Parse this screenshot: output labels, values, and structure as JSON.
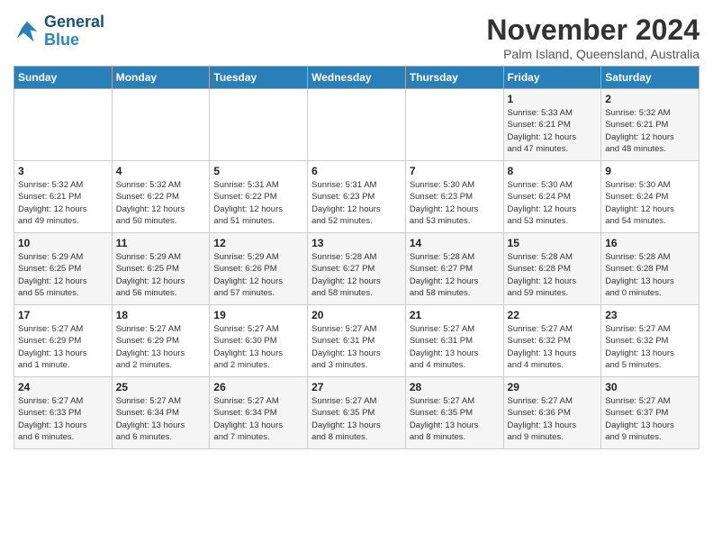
{
  "header": {
    "logo_line1": "General",
    "logo_line2": "Blue",
    "month_title": "November 2024",
    "location": "Palm Island, Queensland, Australia"
  },
  "days_of_week": [
    "Sunday",
    "Monday",
    "Tuesday",
    "Wednesday",
    "Thursday",
    "Friday",
    "Saturday"
  ],
  "weeks": [
    [
      {
        "day": "",
        "info": ""
      },
      {
        "day": "",
        "info": ""
      },
      {
        "day": "",
        "info": ""
      },
      {
        "day": "",
        "info": ""
      },
      {
        "day": "",
        "info": ""
      },
      {
        "day": "1",
        "info": "Sunrise: 5:33 AM\nSunset: 6:21 PM\nDaylight: 12 hours\nand 47 minutes."
      },
      {
        "day": "2",
        "info": "Sunrise: 5:32 AM\nSunset: 6:21 PM\nDaylight: 12 hours\nand 48 minutes."
      }
    ],
    [
      {
        "day": "3",
        "info": "Sunrise: 5:32 AM\nSunset: 6:21 PM\nDaylight: 12 hours\nand 49 minutes."
      },
      {
        "day": "4",
        "info": "Sunrise: 5:32 AM\nSunset: 6:22 PM\nDaylight: 12 hours\nand 50 minutes."
      },
      {
        "day": "5",
        "info": "Sunrise: 5:31 AM\nSunset: 6:22 PM\nDaylight: 12 hours\nand 51 minutes."
      },
      {
        "day": "6",
        "info": "Sunrise: 5:31 AM\nSunset: 6:23 PM\nDaylight: 12 hours\nand 52 minutes."
      },
      {
        "day": "7",
        "info": "Sunrise: 5:30 AM\nSunset: 6:23 PM\nDaylight: 12 hours\nand 53 minutes."
      },
      {
        "day": "8",
        "info": "Sunrise: 5:30 AM\nSunset: 6:24 PM\nDaylight: 12 hours\nand 53 minutes."
      },
      {
        "day": "9",
        "info": "Sunrise: 5:30 AM\nSunset: 6:24 PM\nDaylight: 12 hours\nand 54 minutes."
      }
    ],
    [
      {
        "day": "10",
        "info": "Sunrise: 5:29 AM\nSunset: 6:25 PM\nDaylight: 12 hours\nand 55 minutes."
      },
      {
        "day": "11",
        "info": "Sunrise: 5:29 AM\nSunset: 6:25 PM\nDaylight: 12 hours\nand 56 minutes."
      },
      {
        "day": "12",
        "info": "Sunrise: 5:29 AM\nSunset: 6:26 PM\nDaylight: 12 hours\nand 57 minutes."
      },
      {
        "day": "13",
        "info": "Sunrise: 5:28 AM\nSunset: 6:27 PM\nDaylight: 12 hours\nand 58 minutes."
      },
      {
        "day": "14",
        "info": "Sunrise: 5:28 AM\nSunset: 6:27 PM\nDaylight: 12 hours\nand 58 minutes."
      },
      {
        "day": "15",
        "info": "Sunrise: 5:28 AM\nSunset: 6:28 PM\nDaylight: 12 hours\nand 59 minutes."
      },
      {
        "day": "16",
        "info": "Sunrise: 5:28 AM\nSunset: 6:28 PM\nDaylight: 13 hours\nand 0 minutes."
      }
    ],
    [
      {
        "day": "17",
        "info": "Sunrise: 5:27 AM\nSunset: 6:29 PM\nDaylight: 13 hours\nand 1 minute."
      },
      {
        "day": "18",
        "info": "Sunrise: 5:27 AM\nSunset: 6:29 PM\nDaylight: 13 hours\nand 2 minutes."
      },
      {
        "day": "19",
        "info": "Sunrise: 5:27 AM\nSunset: 6:30 PM\nDaylight: 13 hours\nand 2 minutes."
      },
      {
        "day": "20",
        "info": "Sunrise: 5:27 AM\nSunset: 6:31 PM\nDaylight: 13 hours\nand 3 minutes."
      },
      {
        "day": "21",
        "info": "Sunrise: 5:27 AM\nSunset: 6:31 PM\nDaylight: 13 hours\nand 4 minutes."
      },
      {
        "day": "22",
        "info": "Sunrise: 5:27 AM\nSunset: 6:32 PM\nDaylight: 13 hours\nand 4 minutes."
      },
      {
        "day": "23",
        "info": "Sunrise: 5:27 AM\nSunset: 6:32 PM\nDaylight: 13 hours\nand 5 minutes."
      }
    ],
    [
      {
        "day": "24",
        "info": "Sunrise: 5:27 AM\nSunset: 6:33 PM\nDaylight: 13 hours\nand 6 minutes."
      },
      {
        "day": "25",
        "info": "Sunrise: 5:27 AM\nSunset: 6:34 PM\nDaylight: 13 hours\nand 6 minutes."
      },
      {
        "day": "26",
        "info": "Sunrise: 5:27 AM\nSunset: 6:34 PM\nDaylight: 13 hours\nand 7 minutes."
      },
      {
        "day": "27",
        "info": "Sunrise: 5:27 AM\nSunset: 6:35 PM\nDaylight: 13 hours\nand 8 minutes."
      },
      {
        "day": "28",
        "info": "Sunrise: 5:27 AM\nSunset: 6:35 PM\nDaylight: 13 hours\nand 8 minutes."
      },
      {
        "day": "29",
        "info": "Sunrise: 5:27 AM\nSunset: 6:36 PM\nDaylight: 13 hours\nand 9 minutes."
      },
      {
        "day": "30",
        "info": "Sunrise: 5:27 AM\nSunset: 6:37 PM\nDaylight: 13 hours\nand 9 minutes."
      }
    ]
  ]
}
